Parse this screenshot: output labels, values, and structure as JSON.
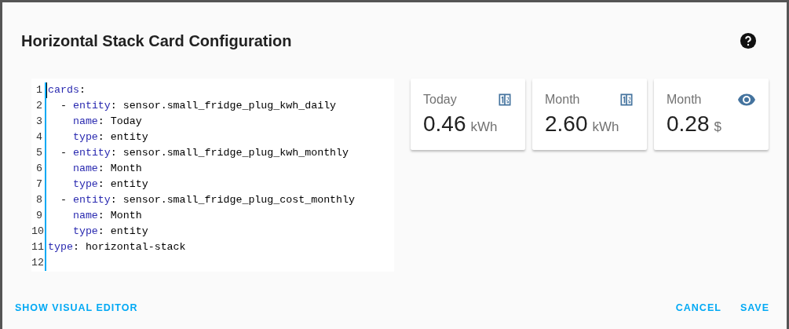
{
  "dialog": {
    "title": "Horizontal Stack Card Configuration"
  },
  "editor": {
    "lines": [
      {
        "number": "1",
        "kind": "top",
        "key": "cards",
        "rest": ":"
      },
      {
        "number": "2",
        "kind": "item",
        "dash": "-",
        "key": "entity",
        "rest": ": sensor.small_fridge_plug_kwh_daily"
      },
      {
        "number": "3",
        "kind": "field",
        "key": "name",
        "rest": ": Today"
      },
      {
        "number": "4",
        "kind": "field",
        "key": "type",
        "rest": ": entity"
      },
      {
        "number": "5",
        "kind": "item",
        "dash": "-",
        "key": "entity",
        "rest": ": sensor.small_fridge_plug_kwh_monthly"
      },
      {
        "number": "6",
        "kind": "field",
        "key": "name",
        "rest": ": Month"
      },
      {
        "number": "7",
        "kind": "field",
        "key": "type",
        "rest": ": entity"
      },
      {
        "number": "8",
        "kind": "item",
        "dash": "-",
        "key": "entity",
        "rest": ": sensor.small_fridge_plug_cost_monthly"
      },
      {
        "number": "9",
        "kind": "field",
        "key": "name",
        "rest": ": Month"
      },
      {
        "number": "10",
        "kind": "field",
        "key": "type",
        "rest": ": entity"
      },
      {
        "number": "11",
        "kind": "top",
        "key": "type",
        "rest": ": horizontal-stack"
      },
      {
        "number": "12",
        "kind": "blank"
      }
    ]
  },
  "preview": [
    {
      "name": "Today",
      "kind": "counter",
      "value": "0.46",
      "unit": "kWh"
    },
    {
      "name": "Month",
      "kind": "counter",
      "value": "2.60",
      "unit": "kWh"
    },
    {
      "name": "Month",
      "kind": "eye",
      "value": "0.28",
      "unit": "$"
    }
  ],
  "footer": {
    "left": "SHOW VISUAL EDITOR",
    "buttons": [
      "CANCEL",
      "SAVE"
    ]
  }
}
